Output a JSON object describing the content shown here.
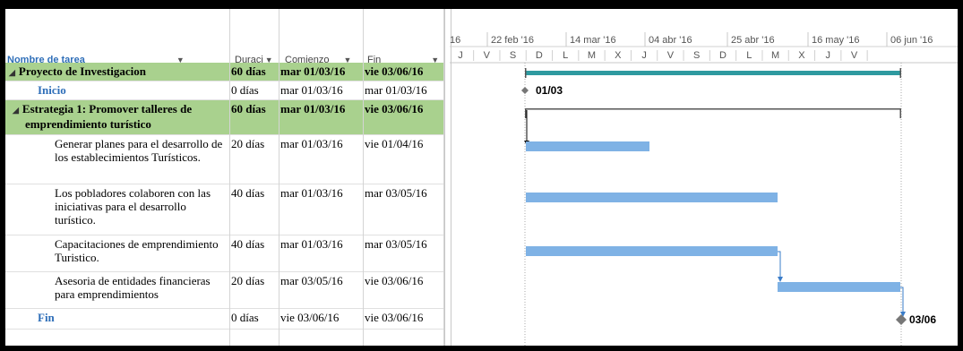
{
  "columns": {
    "task_name": "Nombre de tarea",
    "duration": "Duraci",
    "start": "Comienzo",
    "finish": "Fin"
  },
  "tasks": [
    {
      "name": "Proyecto de Investigacion",
      "duration": "60 días",
      "start": "mar 01/03/16",
      "finish": "vie 03/06/16",
      "type": "summary",
      "indent": 0
    },
    {
      "name": "Inicio",
      "duration": "0 días",
      "start": "mar 01/03/16",
      "finish": "mar 01/03/16",
      "type": "milestone",
      "indent": 1
    },
    {
      "name": "Estrategia 1: Promover talleres de emprendimiento turístico",
      "duration": "60 días",
      "start": "mar 01/03/16",
      "finish": "vie 03/06/16",
      "type": "summary",
      "indent": 1
    },
    {
      "name": "Generar planes para el desarrollo de los establecimientos Turísticos.",
      "duration": "20 días",
      "start": "mar 01/03/16",
      "finish": "vie 01/04/16",
      "type": "task",
      "indent": 2
    },
    {
      "name": "Los pobladores colaboren con las iniciativas para el desarrollo turístico.",
      "duration": "40 días",
      "start": "mar 01/03/16",
      "finish": "mar 03/05/16",
      "type": "task",
      "indent": 2
    },
    {
      "name": "Capacitaciones de emprendimiento Turistico.",
      "duration": "40 días",
      "start": "mar 01/03/16",
      "finish": "mar 03/05/16",
      "type": "task",
      "indent": 2
    },
    {
      "name": "Asesoria de entidades financieras para emprendimientos",
      "duration": "20 días",
      "start": "mar 03/05/16",
      "finish": "vie 03/06/16",
      "type": "task",
      "indent": 2
    },
    {
      "name": "Fin",
      "duration": "0 días",
      "start": "vie 03/06/16",
      "finish": "vie 03/06/16",
      "type": "milestone",
      "indent": 1
    }
  ],
  "timeline": {
    "major": [
      "16",
      "22 feb '16",
      "14 mar '16",
      "04 abr '16",
      "25 abr '16",
      "16 may '16",
      "06 jun '16"
    ],
    "minor": [
      "J",
      "V",
      "S",
      "D",
      "L",
      "M",
      "X",
      "J",
      "V",
      "S",
      "D",
      "L",
      "M",
      "X",
      "J",
      "V"
    ]
  },
  "milestone_labels": {
    "inicio": "01/03",
    "fin": "03/06"
  },
  "colors": {
    "summary_row": "#a9d18e",
    "summary_bar": "#2e9aa0",
    "task_bar": "#7fb2e5",
    "link_text": "#2e6eb8"
  }
}
